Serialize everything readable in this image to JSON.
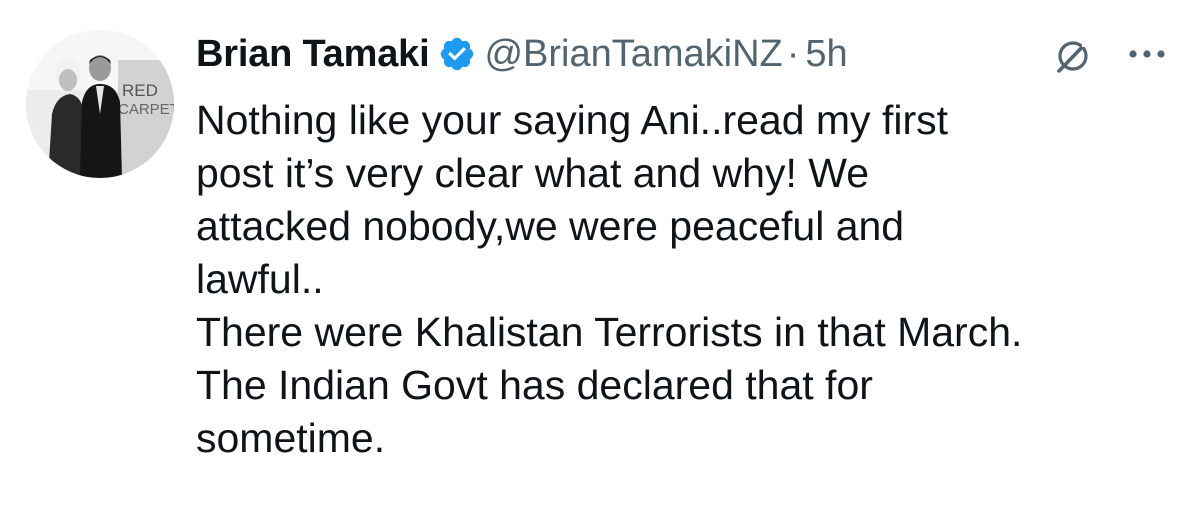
{
  "author": {
    "display_name": "Brian Tamaki",
    "verified_icon": "verified-badge-icon",
    "handle": "@BrianTamakiNZ",
    "separator": "·",
    "time": "5h",
    "avatar_text_1": "RED",
    "avatar_text_2": "CARPET"
  },
  "actions": {
    "grok_icon": "grok-icon",
    "more_icon": "more-icon"
  },
  "tweet": {
    "paragraphs": [
      "Nothing like your saying Ani..read my first\npost it’s very clear what and why! We\nattacked nobody,we were peaceful and\nlawful..",
      "There were Khalistan Terrorists in that March.\nThe Indian Govt has declared that for\nsometime."
    ]
  },
  "colors": {
    "text_primary": "#0f1419",
    "text_secondary": "#536471",
    "verified": "#1d9bf0"
  }
}
